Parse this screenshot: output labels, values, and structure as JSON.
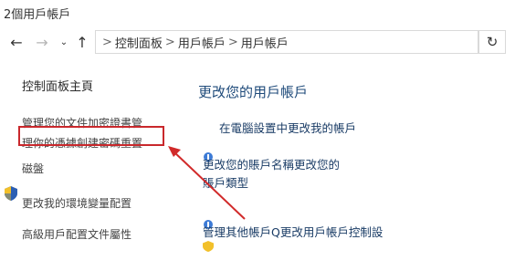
{
  "window": {
    "title": "2個用戶帳戶"
  },
  "nav": {
    "back_icon": "back-arrow-icon",
    "forward_icon": "forward-arrow-icon",
    "recent_icon": "chevron-down-icon",
    "up_icon": "up-arrow-icon",
    "breadcrumb": [
      {
        "label": "控制面板"
      },
      {
        "label": "用戶帳戶"
      },
      {
        "label": "用戶帳戶"
      }
    ],
    "refresh_icon": "refresh-icon"
  },
  "sidebar": {
    "items": [
      {
        "label": "控制面板主頁"
      },
      {
        "label": "管理您的文件加密證書管"
      },
      {
        "label": "理你的憑據創建密碼重置"
      },
      {
        "label": "磁盤"
      },
      {
        "label": "更改我的環境變量配置"
      },
      {
        "label": "高級用戶配置文件屬性"
      }
    ]
  },
  "main": {
    "heading": "更改您的用戶帳戶",
    "links": [
      {
        "label": "在電腦設置中更改我的帳戶"
      },
      {
        "label": "更改您的賬戶名稱更改您的"
      },
      {
        "label": "賬戶類型"
      },
      {
        "label": "管理其他帳戶Q更改用戶帳戶控制設"
      }
    ]
  },
  "colors": {
    "highlight": "#c9282c",
    "link": "#1a3c66",
    "heading": "#1e4a7a"
  }
}
